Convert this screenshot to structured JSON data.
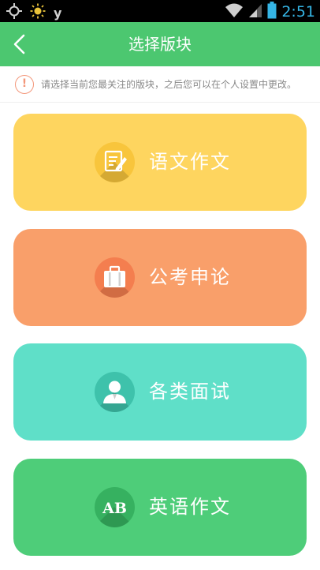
{
  "status_bar": {
    "time": "2:51",
    "notif_letter": "y"
  },
  "header": {
    "title": "选择版块"
  },
  "notice": {
    "icon": "!",
    "text": "请选择当前您最关注的版块，之后您可以在个人设置中更改。"
  },
  "sections": [
    {
      "label": "语文作文",
      "icon": "pen-paper-icon",
      "color": "#fed55f",
      "badge": "#f8c53c"
    },
    {
      "label": "公考申论",
      "icon": "briefcase-icon",
      "color": "#f99f6a",
      "badge": "#f47e4f"
    },
    {
      "label": "各类面试",
      "icon": "person-icon",
      "color": "#5fdfc8",
      "badge": "#3ec2ab"
    },
    {
      "label": "英语作文",
      "icon": "ab-letters-icon",
      "icon_text": "AB",
      "color": "#4ecd79",
      "badge": "#36b160"
    }
  ]
}
